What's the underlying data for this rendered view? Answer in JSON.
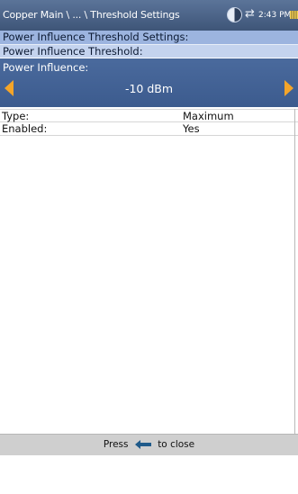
{
  "header": {
    "breadcrumb": "Copper Main \\ ... \\ Threshold Settings",
    "time": "2:43 PM",
    "globe_icon": "globe-icon",
    "swap_icon": "swap-arrows-icon",
    "battery_icon": "battery-icon"
  },
  "section_title": "Power Influence Threshold Settings:",
  "subsection_title": "Power Influence Threshold:",
  "selector": {
    "label": "Power Influence:",
    "value": "-10 dBm",
    "left_icon": "arrow-left-icon",
    "right_icon": "arrow-right-icon"
  },
  "fields": [
    {
      "key": "Type:",
      "value": "Maximum"
    },
    {
      "key": "Enabled:",
      "value": "Yes"
    }
  ],
  "footer": {
    "press": "Press",
    "close": "to close",
    "icon": "back-arrow-icon"
  },
  "colors": {
    "header_bg": "#4a6390",
    "section_bg": "#9cb4df",
    "subsection_bg": "#c4d3ee",
    "selector_bg": "#4465a0",
    "arrow": "#f4a529",
    "footer_bg": "#cfcfcf",
    "back_icon": "#1f5a8a"
  }
}
